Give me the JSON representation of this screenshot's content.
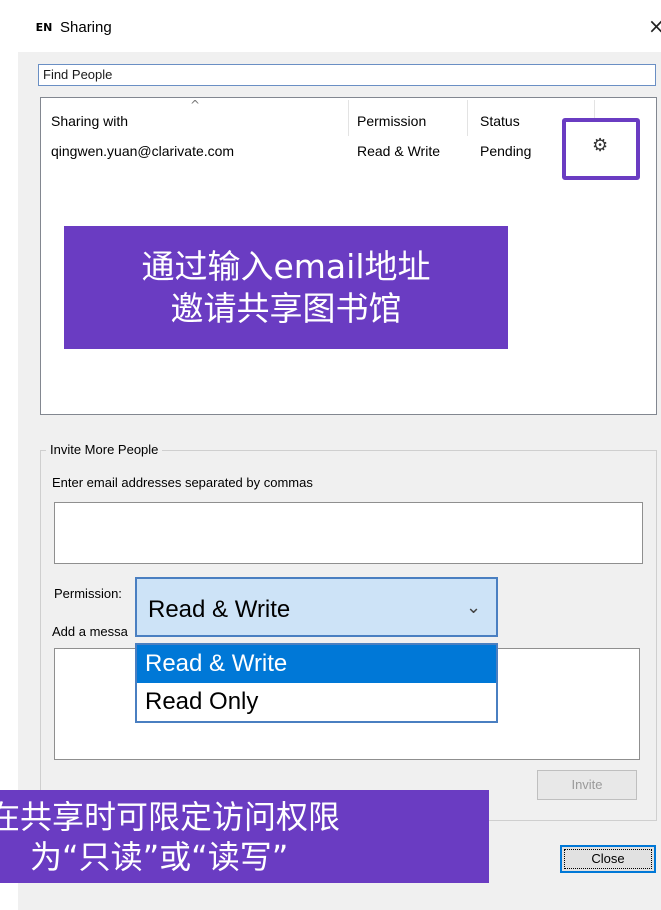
{
  "window": {
    "icon_text": "EN",
    "title": "Sharing",
    "close_glyph": "×"
  },
  "find_people": {
    "placeholder": "Find People"
  },
  "sharing_list": {
    "columns": [
      "Sharing with",
      "Permission",
      "Status"
    ],
    "rows": [
      {
        "email": "qingwen.yuan@clarivate.com",
        "permission": "Read & Write",
        "status": "Pending",
        "action_icon": "gear-icon"
      }
    ]
  },
  "callout_top": {
    "line1": "通过输入email地址",
    "line2": "邀请共享图书馆"
  },
  "invite": {
    "group_label": "Invite More People",
    "email_label": "Enter email addresses separated by commas",
    "email_value": "",
    "permission_label": "Permission:",
    "message_label": "Add a messa",
    "message_value": "",
    "invite_button": "Invite"
  },
  "permission_select": {
    "selected": "Read & Write",
    "options": [
      "Read & Write",
      "Read Only"
    ],
    "highlighted_index": 0
  },
  "callout_bottom": {
    "line1": "在共享时可限定访问权限",
    "line2": "为“只读”或“读写”"
  },
  "footer": {
    "close_button": "Close"
  },
  "colors": {
    "callout": "#6a3cc2",
    "selection": "#0078d7",
    "dialog_bg": "#f0f0f0"
  }
}
